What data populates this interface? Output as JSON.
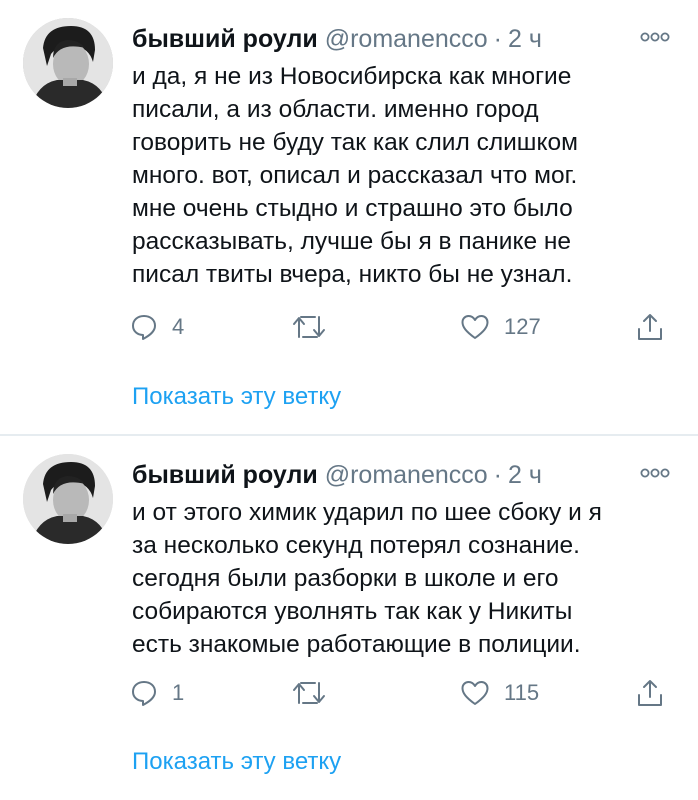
{
  "tweets": [
    {
      "display_name": "бывший роули",
      "handle": "@romanencco",
      "separator": "·",
      "time": "2 ч",
      "lines": [
        "и да, я не из Новосибирска как многие",
        "писали, а из области. именно город",
        "говорить не буду так как слил слишком",
        "много. вот, описал и рассказал что мог.",
        "мне очень стыдно и страшно это было",
        "рассказывать, лучше бы я в панике не",
        "писал твиты вчера, никто бы не узнал."
      ],
      "replies": "4",
      "likes": "127",
      "thread_link": "Показать эту ветку"
    },
    {
      "display_name": "бывший роули",
      "handle": "@romanencco",
      "separator": "·",
      "time": "2 ч",
      "lines": [
        "и от этого химик ударил по шее сбоку и я",
        "за несколько секунд потерял сознание.",
        "сегодня были разборки в школе и его",
        "собираются уволнять так как у Никиты",
        "есть знакомые работающие в полиции."
      ],
      "replies": "1",
      "likes": "115",
      "thread_link": "Показать эту ветку"
    }
  ],
  "icons": {
    "more": "more-options-icon",
    "reply": "reply-icon",
    "retweet": "retweet-icon",
    "like": "like-icon",
    "share": "share-icon"
  },
  "colors": {
    "text": "#0f1419",
    "secondary": "#657786",
    "link": "#1da1f2",
    "divider": "#e6ecf0"
  }
}
